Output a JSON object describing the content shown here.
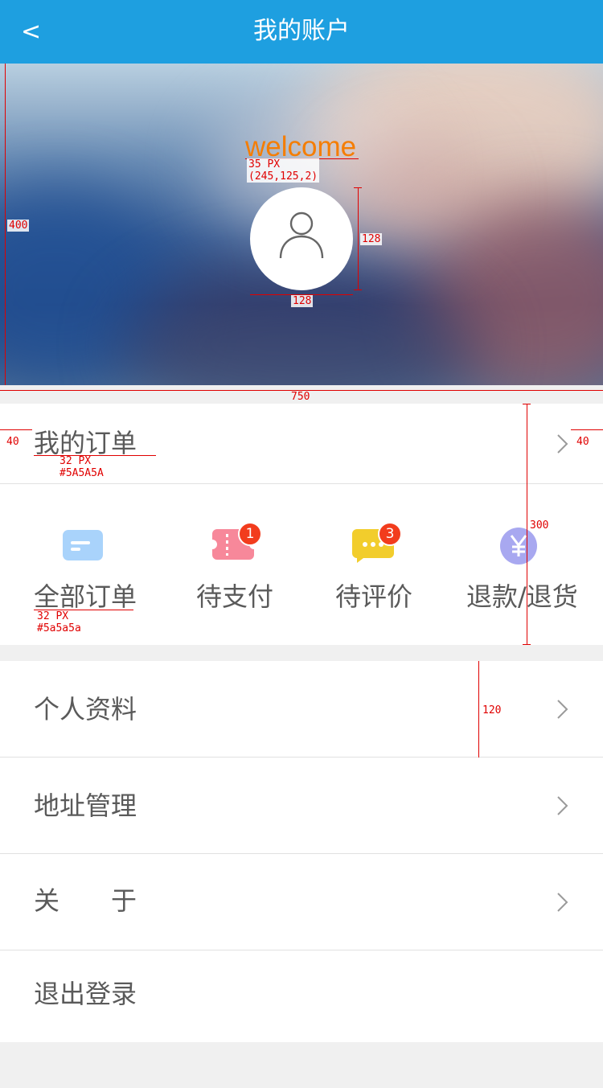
{
  "header": {
    "back_label": "<",
    "title": "我的账户"
  },
  "hero": {
    "welcome_text": "welcome",
    "welcome_color": "#F57D02",
    "avatar_icon": "user-icon"
  },
  "annotations": {
    "welcome_size": "35 PX",
    "welcome_rgb": "(245,125,2)",
    "hero_height": "400",
    "avatar_h": "128",
    "avatar_w": "128",
    "page_width": "750",
    "pad_left": "40",
    "pad_right": "40",
    "title_size": "32 PX",
    "title_color": "#5A5A5A",
    "section_height": "300",
    "item_size": "32 PX",
    "item_color": "#5a5a5a",
    "row_height": "120"
  },
  "orders": {
    "title": "我的订单",
    "items": [
      {
        "label": "全部订单",
        "icon": "list-card-icon",
        "badge": ""
      },
      {
        "label": "待支付",
        "icon": "ticket-icon",
        "badge": "1"
      },
      {
        "label": "待评价",
        "icon": "chat-bubble-icon",
        "badge": "3"
      },
      {
        "label": "退款/退货",
        "icon": "yen-icon",
        "badge": ""
      }
    ]
  },
  "menu": [
    {
      "label": "个人资料",
      "chevron": true
    },
    {
      "label": "地址管理",
      "chevron": true
    },
    {
      "label": "关　　于",
      "chevron": true
    },
    {
      "label": "退出登录",
      "chevron": false
    }
  ],
  "colors": {
    "header_bg": "#1E9FE0",
    "text": "#5A5A5A",
    "badge": "#F23C1D",
    "icon_blue": "#A9D3FB",
    "icon_pink": "#F7889A",
    "icon_yellow": "#F2CD2C",
    "icon_purple": "#A8A8F0"
  }
}
